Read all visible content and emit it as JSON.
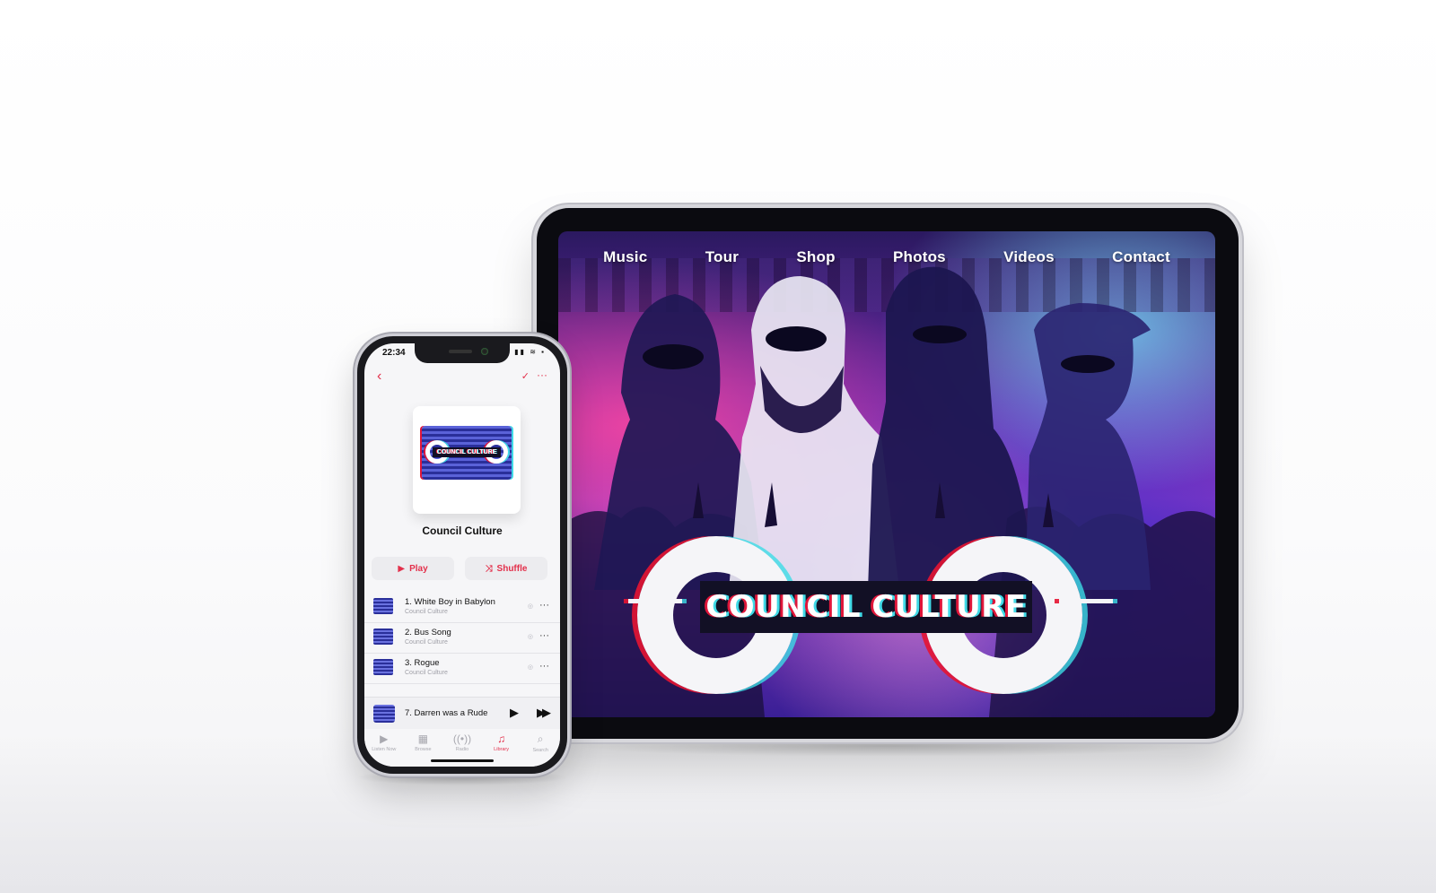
{
  "tablet": {
    "nav": [
      "Music",
      "Tour",
      "Shop",
      "Photos",
      "Videos",
      "Contact"
    ],
    "logo_text": "COUNCIL CULTURE"
  },
  "phone": {
    "status_time": "22:34",
    "status_icons": "▮▮ ≋ ▪",
    "artwork_label": "COUNCIL CULTURE",
    "album_title": "Council Culture",
    "play_label": "Play",
    "shuffle_label": "Shuffle",
    "tracks": [
      {
        "title": "1. White Boy in Babylon",
        "artist": "Council Culture"
      },
      {
        "title": "2. Bus Song",
        "artist": "Council Culture"
      },
      {
        "title": "3. Rogue",
        "artist": "Council Culture"
      }
    ],
    "now_playing": "7. Darren was a Rude",
    "tabs": [
      {
        "label": "Listen Now",
        "icon": "play-circle-icon"
      },
      {
        "label": "Browse",
        "icon": "grid-icon"
      },
      {
        "label": "Radio",
        "icon": "radio-icon"
      },
      {
        "label": "Library",
        "icon": "music-note-icon"
      },
      {
        "label": "Search",
        "icon": "search-icon"
      }
    ],
    "active_tab": "Library"
  },
  "colors": {
    "accent": "#e3304b",
    "glitch_red": "#e0163a",
    "glitch_cyan": "#3fd9e6",
    "stage_purple": "#6b2aa8"
  }
}
